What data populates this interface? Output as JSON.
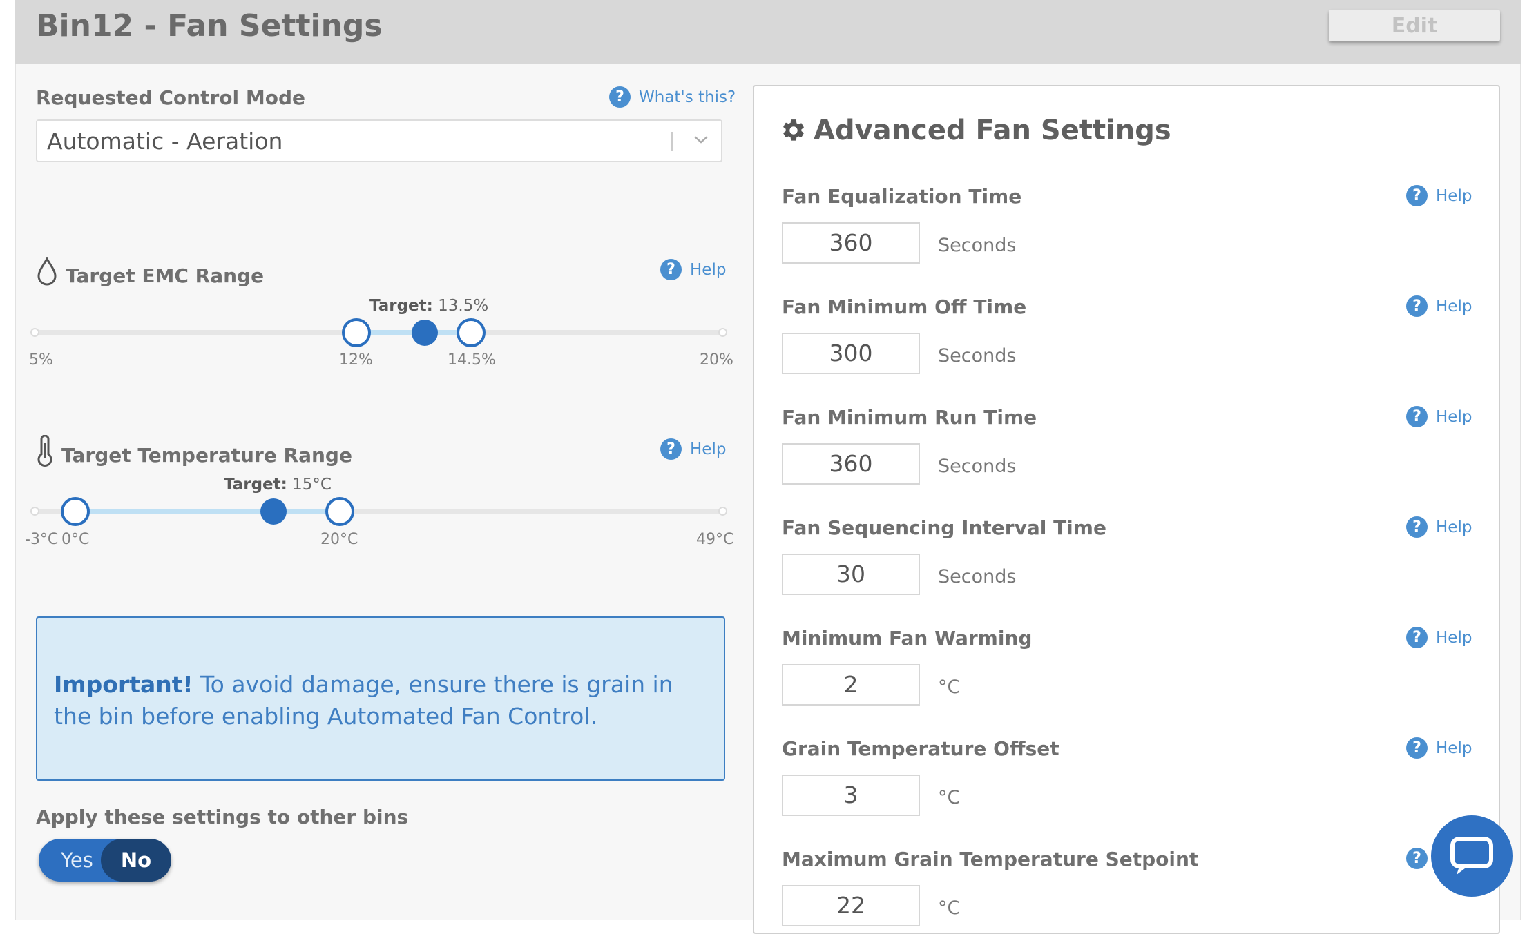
{
  "header": {
    "title": "Bin12 - Fan Settings",
    "edit_label": "Edit"
  },
  "control_mode": {
    "label": "Requested Control Mode",
    "whats_this": "What's this?",
    "selected": "Automatic - Aeration"
  },
  "emc_range": {
    "label": "Target EMC Range",
    "help": "Help",
    "target_label": "Target:",
    "target_value": "13.5%",
    "min_label": "5%",
    "max_label": "20%",
    "low_label": "12%",
    "high_label": "14.5%",
    "min": 5,
    "max": 20,
    "low": 12,
    "high": 14.5,
    "target": 13.5
  },
  "temp_range": {
    "label": "Target Temperature Range",
    "help": "Help",
    "target_label": "Target:",
    "target_value": "15°C",
    "min_label": "-3°C",
    "max_label": "49°C",
    "low_label": "0°C",
    "high_label": "20°C",
    "min": -3,
    "max": 49,
    "low": 0,
    "high": 20,
    "target": 15
  },
  "notice": {
    "strong": "Important!",
    "text": " To avoid damage, ensure there is grain in the bin before enabling Automated Fan Control."
  },
  "apply": {
    "label": "Apply these settings to other bins",
    "yes": "Yes",
    "no": "No",
    "selected": "No"
  },
  "advanced": {
    "title": "Advanced Fan Settings",
    "help": "Help",
    "settings": [
      {
        "label": "Fan Equalization Time",
        "value": "360",
        "unit": "Seconds"
      },
      {
        "label": "Fan Minimum Off Time",
        "value": "300",
        "unit": "Seconds"
      },
      {
        "label": "Fan Minimum Run Time",
        "value": "360",
        "unit": "Seconds"
      },
      {
        "label": "Fan Sequencing Interval Time",
        "value": "30",
        "unit": "Seconds"
      },
      {
        "label": "Minimum Fan Warming",
        "value": "2",
        "unit": "°C"
      },
      {
        "label": "Grain Temperature Offset",
        "value": "3",
        "unit": "°C"
      },
      {
        "label": "Maximum Grain Temperature Setpoint",
        "value": "22",
        "unit": "°C"
      }
    ]
  },
  "colors": {
    "accent": "#2a6fbf",
    "help_blue": "#4a8fd0",
    "notice_bg": "#d9ebf7",
    "toggle_active": "#1c4474"
  }
}
